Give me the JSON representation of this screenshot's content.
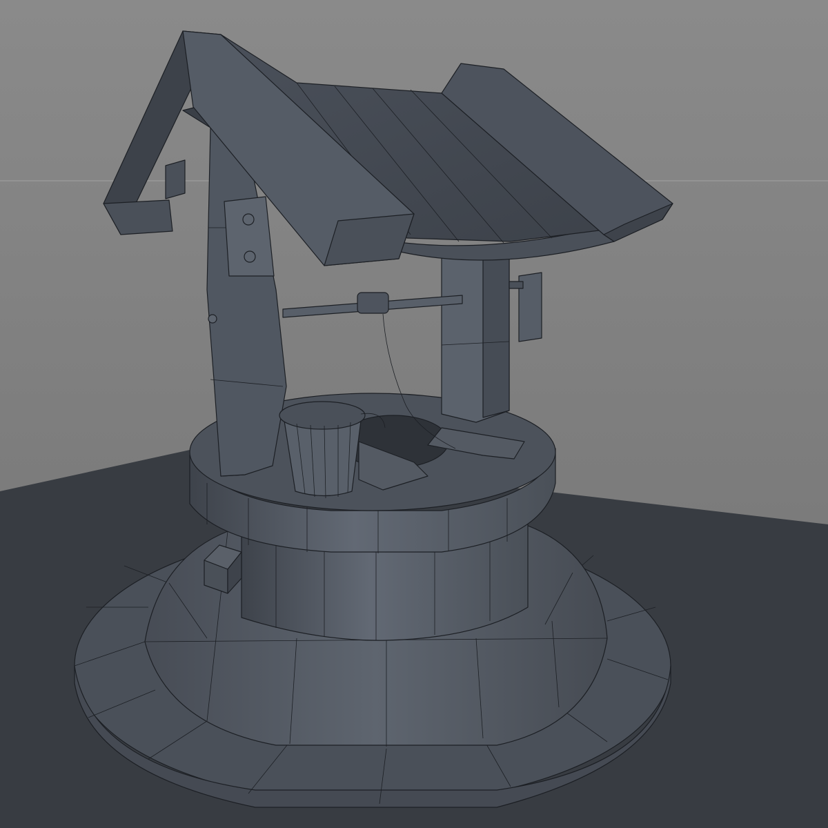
{
  "scene": {
    "subject": "wishing-well",
    "render_style": "wireframe-on-shaded",
    "colors": {
      "background": "#7d7d7d",
      "floor": "#383c42",
      "model_dark": "#3b4048",
      "model_mid": "#4f5560",
      "model_light": "#646b76",
      "wire": "#1c1f24",
      "horizon_line": "#a4a4a4"
    }
  }
}
